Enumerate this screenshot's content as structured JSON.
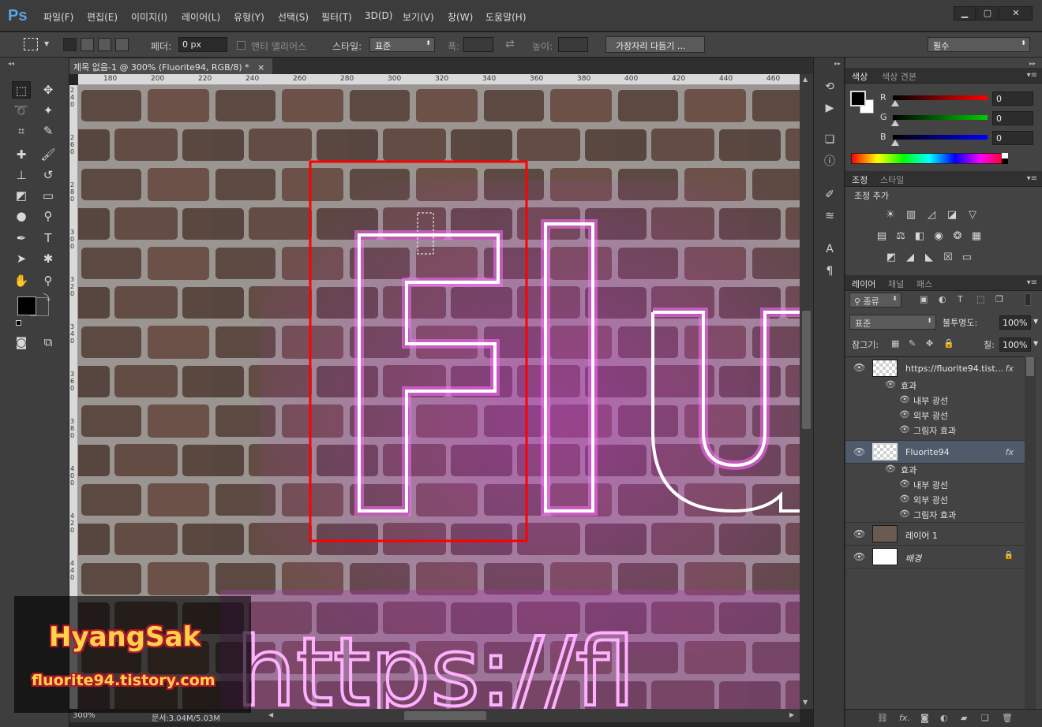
{
  "menubar": {
    "logo": "Ps",
    "items": [
      "파일(F)",
      "편집(E)",
      "이미지(I)",
      "레이어(L)",
      "유형(Y)",
      "선택(S)",
      "필터(T)",
      "3D(D)",
      "보기(V)",
      "창(W)",
      "도움말(H)"
    ],
    "window_buttons": [
      "▁",
      "▢",
      "✕"
    ]
  },
  "options": {
    "feather_label": "페더:",
    "feather_value": "0 px",
    "antialias_label": "앤티 앨리어스",
    "style_label": "스타일:",
    "style_value": "표준",
    "width_label": "폭:",
    "height_label": "높이:",
    "refine_button": "가장자리 다듬기 ...",
    "workspace": "필수"
  },
  "document": {
    "tab_title": "제목 없음-1 @ 300% (Fluorite94, RGB/8) *",
    "close": "×",
    "ruler_top": [
      "180",
      "200",
      "220",
      "240",
      "260",
      "280",
      "300",
      "320",
      "340",
      "360",
      "380",
      "400",
      "420",
      "440",
      "460"
    ],
    "ruler_left": [
      "2 4 0",
      "2 6 0",
      "2 8 0",
      "3 0 0",
      "3 2 0",
      "3 4 0",
      "3 6 0",
      "3 8 0",
      "4 0 0",
      "4 2 0",
      "4 4 0"
    ],
    "canvas_text_main": "Flu",
    "canvas_text_url": "https://fl",
    "zoom": "300%",
    "doc_size": "문서:3.04M/5.03M"
  },
  "watermark": {
    "name": "HyangSak",
    "url": "fluorite94.tistory.com"
  },
  "color_panel": {
    "tabs": [
      "색상",
      "색상 견본"
    ],
    "channels": [
      {
        "label": "R",
        "value": "0"
      },
      {
        "label": "G",
        "value": "0"
      },
      {
        "label": "B",
        "value": "0"
      }
    ],
    "foreground": "#000000",
    "background": "#ffffff"
  },
  "adjust_panel": {
    "tabs": [
      "조정",
      "스타일"
    ],
    "title": "조정 추가"
  },
  "layers_panel": {
    "tabs": [
      "레이어",
      "채널",
      "패스"
    ],
    "filter_kind": "종류",
    "blend_mode": "표준",
    "opacity_label": "불투명도:",
    "opacity": "100%",
    "lock_label": "잠그기:",
    "fill_label": "칠:",
    "fill": "100%",
    "layers": [
      {
        "name": "https://fluorite94.tist...",
        "fx": "fx",
        "effects_label": "효과",
        "effects": [
          "내부 광선",
          "외부 광선",
          "그림자 효과"
        ]
      },
      {
        "name": "Fluorite94",
        "fx": "fx",
        "effects_label": "효과",
        "effects": [
          "내부 광선",
          "외부 광선",
          "그림자 효과"
        ]
      },
      {
        "name": "레이어 1"
      },
      {
        "name": "배경"
      }
    ]
  },
  "colors": {
    "selection_outline": "#ff0000",
    "neon": "#ff66ff"
  }
}
